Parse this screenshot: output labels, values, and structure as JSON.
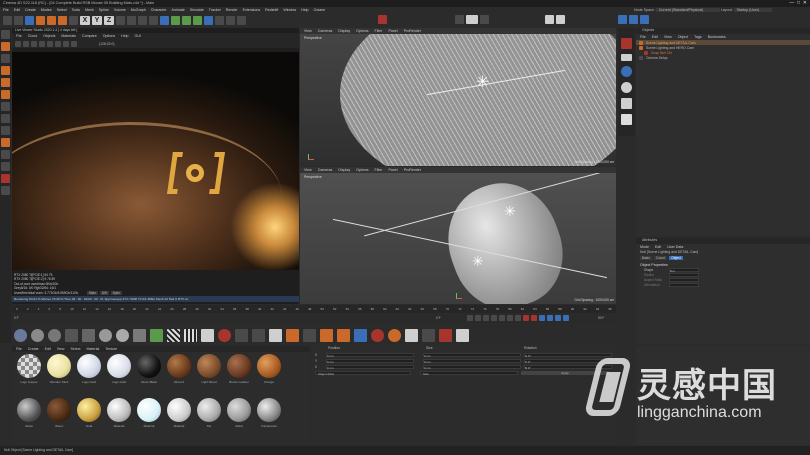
{
  "window": {
    "title": "Cinema 4D S22.118 (RC) - [04 Complete Build RSB Mouse 05 Building Mats.c4d *] - Main"
  },
  "main_menu": [
    "File",
    "Edit",
    "Create",
    "Modes",
    "Select",
    "Tools",
    "Mesh",
    "Spline",
    "Volume",
    "MoGraph",
    "Character",
    "Animate",
    "Simulate",
    "Tracker",
    "Render",
    "Extensions",
    "Redshift",
    "Window",
    "Help",
    "Octane"
  ],
  "node_space": {
    "label": "Node Space:",
    "value": "Current (Standard/Physical)"
  },
  "layout": {
    "label": "Layout:",
    "value": "Startup (User)"
  },
  "live_viewer": {
    "title": "Live Viewer Studio 2020.1.4 [ 4 days left ]",
    "menu": [
      "File",
      "Cloud",
      "Objects",
      "Materials",
      "Compare",
      "Options",
      "Help",
      "GUI"
    ],
    "zoom": "(128:32:0)",
    "status_line": "Rendering 84.64 % Ms/sec 15.39 % Time 00 : 00 : 01/00 : 00 : 01 Spp/maxspp 373 / 5000 Tri 0/1.398m Mesh 22 Hair 0 RTX:on",
    "gpu_info": [
      "RTX 2080 Ti[PCIE:1] 94 75",
      "RTX 2080 Ti[PCIE:2] 9.76 89",
      "Out-of-core used/max:0Kb/4Gb",
      "Grey8/16: 0/0 Rgb32/64: 16/1",
      "Used/free/total vram: 3.773Gb/5.569Gb/11Gb"
    ],
    "tabs": [
      "Main",
      "Diff",
      "Spec"
    ]
  },
  "viewport_top": {
    "menu": [
      "View",
      "Cameras",
      "Display",
      "Options",
      "Filter",
      "Panel",
      "ProRender"
    ],
    "name": "Perspective",
    "grid": "Grid Spacing : 1000,000 cm"
  },
  "viewport_bottom": {
    "menu": [
      "View",
      "Cameras",
      "Display",
      "Options",
      "Filter",
      "Panel",
      "ProRender"
    ],
    "name": "Perspective",
    "grid": "Grid Spacing : 1000,000 cm"
  },
  "objects": {
    "title": "Objects",
    "menu": [
      "File",
      "Edit",
      "View",
      "Object",
      "Tags",
      "Bookmarks"
    ],
    "items": [
      "Scene Lighting and DETAIL Cam",
      "Scene Lighting and HERO Cam",
      "Snap Null Ctrl",
      "Cinema Setup"
    ]
  },
  "attributes": {
    "title": "Attributes",
    "menu": [
      "Mode",
      "Edit",
      "User Data"
    ],
    "object": "Null [Scene Lighting and DETAIL Cam]",
    "tabs": [
      "Basic",
      "Coord.",
      "Object"
    ],
    "section": "Object Properties",
    "props": [
      {
        "k": "Shape",
        "v": "Dot"
      },
      {
        "k": "Radius",
        "v": ""
      },
      {
        "k": "Aspect Ratio",
        "v": ""
      },
      {
        "k": "Orientation",
        "v": ""
      }
    ]
  },
  "timeline": {
    "ticks": [
      "0",
      "2",
      "4",
      "6",
      "8",
      "10",
      "12",
      "14",
      "16",
      "18",
      "20",
      "22",
      "24",
      "26",
      "28",
      "30",
      "32",
      "34",
      "36",
      "38",
      "40",
      "42",
      "44",
      "46",
      "48",
      "50",
      "52",
      "54",
      "56",
      "58",
      "60",
      "62",
      "64",
      "66",
      "68",
      "70",
      "72",
      "74",
      "76",
      "78",
      "80",
      "82",
      "84",
      "86",
      "88",
      "90",
      "92",
      "94",
      "96"
    ],
    "start": "0 F",
    "end": "90 F",
    "current": "0 F"
  },
  "materials": {
    "menu": [
      "File",
      "Create",
      "Edit",
      "View",
      "Select",
      "Material",
      "Texture"
    ],
    "row1": [
      "Logo Copper",
      "Wooden Stick",
      "Logo Gold",
      "Logo Gold",
      "Gloss Black",
      "Wood 2",
      "Light Wood",
      "Brown Leather",
      "Orange",
      "Glass"
    ],
    "row2": [
      "Wood",
      "Gold",
      "Material",
      "Material",
      "Material",
      "Tile",
      "Metal",
      "Transparent"
    ]
  },
  "coords": {
    "headers": [
      "Position",
      "Size",
      "Rotation"
    ],
    "rows": [
      {
        "axis": "X",
        "pos": "0 cm",
        "size": "0 cm",
        "rot": "H 0°"
      },
      {
        "axis": "Y",
        "pos": "0 cm",
        "size": "0 cm",
        "rot": "P 0°"
      },
      {
        "axis": "Z",
        "pos": "0 cm",
        "size": "0 cm",
        "rot": "B 0°"
      }
    ],
    "mode": "Object (Rel)",
    "size_mode": "Size",
    "apply": "Apply"
  },
  "status_bar": "Null Object [Scene Lighting and DETAIL Cam]",
  "watermark": {
    "cn": "灵感中国",
    "url": "lingganchina.com"
  }
}
